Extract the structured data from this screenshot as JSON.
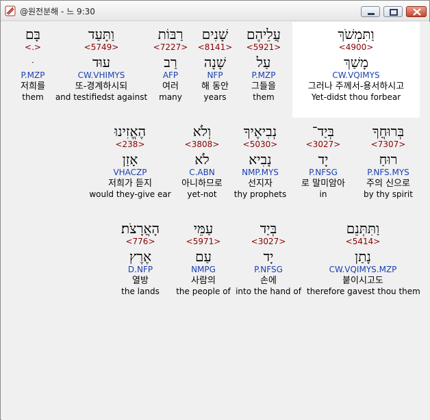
{
  "window": {
    "title": "@원전분해 - 느 9:30"
  },
  "rows": [
    [
      {
        "heb": "וַתִּמְשֹׁךְ",
        "num": "<4900>",
        "lemma": "מָשַׁךְ",
        "morph": "CW.VQIMYS",
        "kor": "그러나 주께서-용서하시고",
        "eng": "Yet-didst thou forbear",
        "selected": true
      },
      {
        "heb": "עֲלֵיהֶם",
        "num": "<5921>",
        "lemma": "עַל",
        "morph": "P.MZP",
        "kor": "그들을",
        "eng": "them"
      },
      {
        "heb": "שָׁנִים",
        "num": "<8141>",
        "lemma": "שָׁנָה",
        "morph": "NFP",
        "kor": "해 동안",
        "eng": "years"
      },
      {
        "heb": "רַבּוֹת",
        "num": "<7227>",
        "lemma": "רַב",
        "morph": "AFP",
        "kor": "여러",
        "eng": "many"
      },
      {
        "heb": "וַתָּעַד",
        "num": "<5749>",
        "lemma": "עוּד",
        "morph": "CW.VHIMYS",
        "kor": "또-경계하시되",
        "eng": "and testifiedst against"
      },
      {
        "heb": "בָּם",
        "num": "<.>",
        "lemma": "ּ",
        "morph": "P.MZP",
        "kor": "저희를",
        "eng": "them"
      }
    ],
    [
      {
        "heb": "בְּרוּחֲךָ",
        "num": "<7307>",
        "lemma": "רוּחַ",
        "morph": "P.NFS.MYS",
        "kor": "주의 신으로",
        "eng": "by thy spirit"
      },
      {
        "heb": "בְּיַד־",
        "num": "<3027>",
        "lemma": "יָד",
        "morph": "P.NFSG",
        "kor": "로 말미암아",
        "eng": "in"
      },
      {
        "heb": "נְבִיאֶיךָ",
        "num": "<5030>",
        "lemma": "נָבִיא",
        "morph": "NMP.MYS",
        "kor": "선지자",
        "eng": "thy prophets"
      },
      {
        "heb": "וְלֹא",
        "num": "<3808>",
        "lemma": "לֹא",
        "morph": "C.ABN",
        "kor": "아니하므로",
        "eng": "yet-not"
      },
      {
        "heb": "הֶאֱזִינוּ",
        "num": "<238>",
        "lemma": "אָזַן",
        "morph": "VHACZP",
        "kor": "저희가 듣지",
        "eng": "would they-give ear"
      }
    ],
    [
      {
        "heb": "וַתִּתְּנֵם",
        "num": "<5414>",
        "lemma": "נָתַן",
        "morph": "CW.VQIMYS.MZP",
        "kor": "붙이시고도",
        "eng": "therefore gavest thou them"
      },
      {
        "heb": "בְּיַד",
        "num": "<3027>",
        "lemma": "יָד",
        "morph": "P.NFSG",
        "kor": "손에",
        "eng": "into the hand of"
      },
      {
        "heb": "עַמֵּי",
        "num": "<5971>",
        "lemma": "עַם",
        "morph": "NMPG",
        "kor": "사람의",
        "eng": "the people of"
      },
      {
        "heb": "הָאֲרָצֹת׃",
        "num": "<776>",
        "lemma": "אֶרֶץ",
        "morph": "D.NFP",
        "kor": "열방",
        "eng": "the lands"
      }
    ]
  ]
}
